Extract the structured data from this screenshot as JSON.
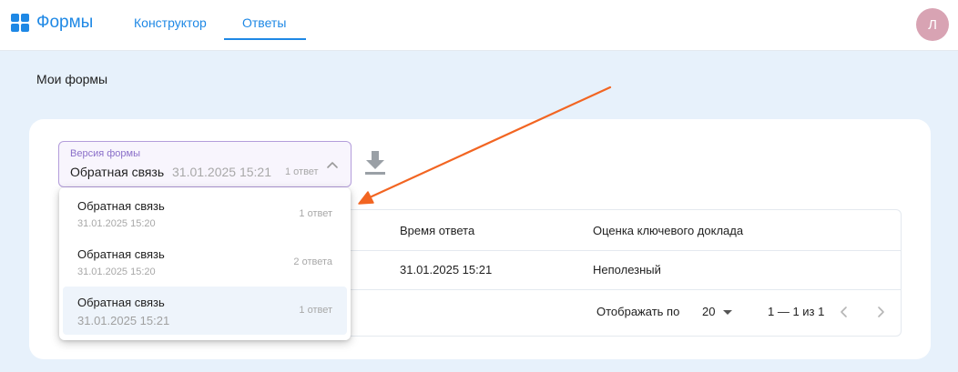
{
  "app": {
    "title": "Формы",
    "accent_color": "#1e88e5",
    "logo_icon": "grid-icon"
  },
  "nav": {
    "tabs": [
      {
        "label": "Конструктор",
        "active": false
      },
      {
        "label": "Ответы",
        "active": true
      }
    ]
  },
  "user": {
    "avatar_initial": "Л",
    "avatar_color": "#d8a3b3"
  },
  "page": {
    "title": "Мои формы"
  },
  "version_select": {
    "label": "Версия формы",
    "selected_name": "Обратная связь",
    "selected_date": "31.01.2025 15:21",
    "selected_count": "1 ответ",
    "expanded": true,
    "options": [
      {
        "name": "Обратная связь",
        "date": "31.01.2025 15:20",
        "count": "1 ответ",
        "selected": false
      },
      {
        "name": "Обратная связь",
        "date": "31.01.2025 15:20",
        "count": "2 ответа",
        "selected": false
      },
      {
        "name": "Обратная связь",
        "date": "31.01.2025 15:21",
        "count": "1 ответ",
        "selected": true
      }
    ]
  },
  "download": {
    "icon": "download-icon"
  },
  "table": {
    "columns": [
      "Время ответа",
      "Оценка ключевого доклада"
    ],
    "rows": [
      [
        "31.01.2025 15:21",
        "Неполезный"
      ]
    ]
  },
  "pagination": {
    "rows_per_page_label": "Отображать по",
    "rows_per_page": "20",
    "range": "1 — 1 из 1"
  },
  "annotation": {
    "arrow_color": "#f26522"
  }
}
